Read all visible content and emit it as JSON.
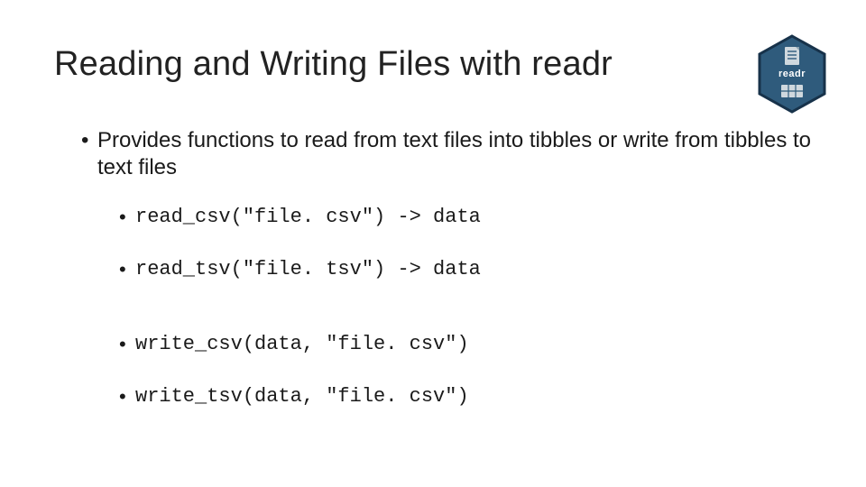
{
  "logo": {
    "label": "readr",
    "color": "#2f5b7c",
    "border": "#17324a",
    "accent": "#cfd8de"
  },
  "title": "Reading and Writing Files with readr",
  "bullets": {
    "main": "Provides functions to read from text files into tibbles or write from tibbles to text files",
    "code": [
      "read_csv(\"file. csv\") -> data",
      "read_tsv(\"file. tsv\") -> data",
      "write_csv(data, \"file. csv\")",
      "write_tsv(data, \"file. csv\")"
    ]
  }
}
